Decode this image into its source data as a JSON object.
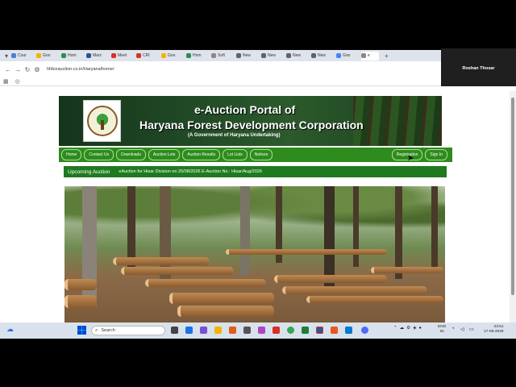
{
  "browser": {
    "tabs": [
      {
        "label": "Cour",
        "color": "#4a7fd6"
      },
      {
        "label": "Goo",
        "color": "#f4b400"
      },
      {
        "label": "Hom",
        "color": "#2e8b57"
      },
      {
        "label": "Marc",
        "color": "#2f4f9f"
      },
      {
        "label": "Meet",
        "color": "#d93025"
      },
      {
        "label": "CRI",
        "color": "#d93025"
      },
      {
        "label": "Goo",
        "color": "#f4b400"
      },
      {
        "label": "Hom",
        "color": "#2e8b57"
      },
      {
        "label": "Soft",
        "color": "#888888"
      },
      {
        "label": "New",
        "color": "#5f6368"
      },
      {
        "label": "New",
        "color": "#5f6368"
      },
      {
        "label": "New",
        "color": "#5f6368"
      },
      {
        "label": "New",
        "color": "#5f6368"
      },
      {
        "label": "Goo",
        "color": "#4285f4"
      },
      {
        "label": "e",
        "color": "#888888",
        "active": true
      }
    ],
    "new_tab": "+",
    "url": "hfdceauction.co.in/Haryana/home/",
    "nav_back": "←",
    "nav_forward": "→",
    "nav_reload": "↻"
  },
  "user_panel": {
    "name": "Roshan Thosar"
  },
  "site": {
    "title_line1": "e-Auction Portal of",
    "title_line2": "Haryana Forest Development Corporation",
    "title_line3": "(A Government of Haryana Undertaking)",
    "nav": [
      "Home",
      "Contact Us",
      "Downloads",
      "Auction Lots",
      "Auction Results",
      "Lot Lists",
      "Notices"
    ],
    "nav_right": [
      "Registration",
      "Sign In"
    ],
    "ticker_label": "Upcoming Auction",
    "ticker_text": "eAuction for Hisar Division on 20/08/2026 E-Auction No : Hisar/Aug/2026"
  },
  "taskbar": {
    "search_placeholder": "Search",
    "lang_line1": "ENG",
    "lang_line2": "IN",
    "time": "23:51",
    "date": "17-08-2026"
  }
}
